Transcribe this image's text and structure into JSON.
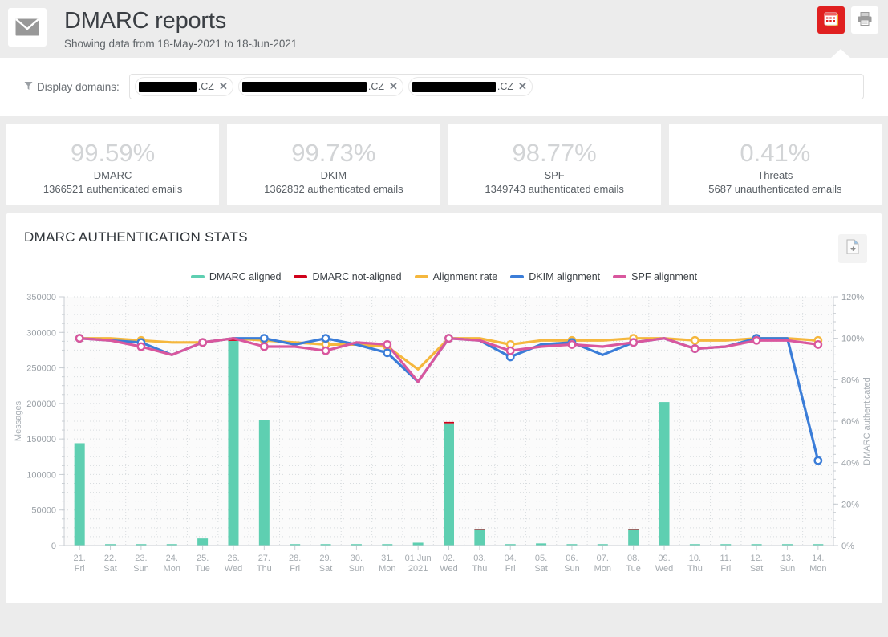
{
  "header": {
    "title": "DMARC reports",
    "subtitle": "Showing data from 18-May-2021 to 18-Jun-2021",
    "logo_icon": "envelope-icon",
    "calendar_button_icon": "calendar-icon",
    "print_button_icon": "printer-icon"
  },
  "filter": {
    "label": "Display domains:",
    "filter_icon": "funnel-icon",
    "chips": [
      {
        "redacted_width": 72,
        "suffix": ".CZ",
        "remove_icon": "close-icon"
      },
      {
        "redacted_width": 155,
        "suffix": ".CZ",
        "remove_icon": "close-icon"
      },
      {
        "redacted_width": 104,
        "suffix": ".CZ",
        "remove_icon": "close-icon"
      }
    ]
  },
  "stats": [
    {
      "percent": "99.59%",
      "name": "DMARC",
      "detail": "1366521 authenticated emails"
    },
    {
      "percent": "99.73%",
      "name": "DKIM",
      "detail": "1362832 authenticated emails"
    },
    {
      "percent": "98.77%",
      "name": "SPF",
      "detail": "1349743 authenticated emails"
    },
    {
      "percent": "0.41%",
      "name": "Threats",
      "detail": "5687 unauthenticated emails"
    }
  ],
  "chart_panel": {
    "title": "DMARC AUTHENTICATION STATS",
    "export_icon": "export-document-icon"
  },
  "colors": {
    "dmarc_aligned": "#5ecfb1",
    "dmarc_not_aligned": "#d0021b",
    "alignment_rate": "#f5b73d",
    "dkim_alignment": "#3b7dd8",
    "spf_alignment": "#d9579e",
    "accent_red": "#e02020",
    "page_bg": "#ececec",
    "card_bg": "#ffffff",
    "stat_value": "#d2d4d6"
  },
  "chart_data": {
    "type": "bar",
    "title": "DMARC AUTHENTICATION STATS",
    "xlabel": "",
    "ylabel": "Messages",
    "y2label": "DMARC authenticated",
    "ylim": [
      0,
      350000
    ],
    "y2lim": [
      0,
      120
    ],
    "yticks": [
      0,
      50000,
      100000,
      150000,
      200000,
      250000,
      300000,
      350000
    ],
    "yticklabels": [
      "0",
      "50000",
      "100000",
      "150000",
      "200000",
      "250000",
      "300000",
      "350000"
    ],
    "y2ticks": [
      0,
      20,
      40,
      60,
      80,
      100,
      120
    ],
    "y2ticklabels": [
      "0%",
      "20%",
      "40%",
      "60%",
      "80%",
      "100%",
      "120%"
    ],
    "grid": true,
    "legend_position": "top-center",
    "categories": [
      "21.\nFri",
      "22.\nSat",
      "23.\nSun",
      "24.\nMon",
      "25.\nTue",
      "26.\nWed",
      "27.\nThu",
      "28.\nFri",
      "29.\nSat",
      "30.\nSun",
      "31.\nMon",
      "01 Jun\n2021",
      "02.\nWed",
      "03.\nThu",
      "04.\nFri",
      "05.\nSat",
      "06.\nSun",
      "07.\nMon",
      "08.\nTue",
      "09.\nWed",
      "10.\nThu",
      "11.\nFri",
      "12.\nSat",
      "13.\nSun",
      "14.\nMon"
    ],
    "categories_flat": [
      "21. Fri",
      "22. Sat",
      "23. Sun",
      "24. Mon",
      "25. Tue",
      "26. Wed",
      "27. Thu",
      "28. Fri",
      "29. Sat",
      "30. Sun",
      "31. Mon",
      "01 Jun 2021",
      "02. Wed",
      "03. Thu",
      "04. Fri",
      "05. Sat",
      "06. Sun",
      "07. Mon",
      "08. Tue",
      "09. Wed",
      "10. Thu",
      "11. Fri",
      "12. Sat",
      "13. Sun",
      "14. Mon"
    ],
    "bar_series": [
      {
        "name": "DMARC aligned",
        "axis": "left",
        "color": "#5ecfb1",
        "values": [
          144000,
          2000,
          2000,
          2000,
          10000,
          288000,
          177000,
          2000,
          2000,
          2000,
          2000,
          4000,
          172000,
          22000,
          2000,
          3000,
          2000,
          2000,
          22000,
          202000,
          2000,
          2000,
          2000,
          2000,
          2000
        ]
      },
      {
        "name": "DMARC not-aligned",
        "axis": "left",
        "color": "#d0021b",
        "values": [
          500,
          100,
          100,
          100,
          300,
          2000,
          500,
          100,
          100,
          400,
          600,
          400,
          2000,
          1200,
          100,
          100,
          100,
          100,
          700,
          600,
          100,
          100,
          100,
          100,
          100
        ]
      }
    ],
    "line_series": [
      {
        "name": "Alignment rate",
        "axis": "right",
        "color": "#f5b73d",
        "units": "%",
        "values": [
          100,
          100,
          99,
          98,
          98,
          100,
          99,
          98,
          97,
          97,
          96,
          85,
          100,
          100,
          97,
          99,
          99,
          99,
          100,
          100,
          99,
          99,
          100,
          100,
          99
        ]
      },
      {
        "name": "DKIM alignment",
        "axis": "right",
        "color": "#3b7dd8",
        "units": "%",
        "values": [
          100,
          99,
          98,
          92,
          98,
          100,
          100,
          97,
          100,
          97,
          93,
          79,
          100,
          99,
          91,
          97,
          98,
          92,
          98,
          100,
          95,
          96,
          100,
          100,
          41
        ]
      },
      {
        "name": "SPF alignment",
        "axis": "right",
        "color": "#d9579e",
        "units": "%",
        "values": [
          100,
          99,
          96,
          92,
          98,
          100,
          96,
          96,
          94,
          98,
          97,
          79,
          100,
          99,
          94,
          96,
          97,
          96,
          98,
          100,
          95,
          96,
          99,
          99,
          97
        ]
      }
    ],
    "legend": [
      {
        "label": "DMARC aligned",
        "color": "#5ecfb1"
      },
      {
        "label": "DMARC not-aligned",
        "color": "#d0021b"
      },
      {
        "label": "Alignment rate",
        "color": "#f5b73d"
      },
      {
        "label": "DKIM alignment",
        "color": "#3b7dd8"
      },
      {
        "label": "SPF alignment",
        "color": "#d9579e"
      }
    ]
  }
}
